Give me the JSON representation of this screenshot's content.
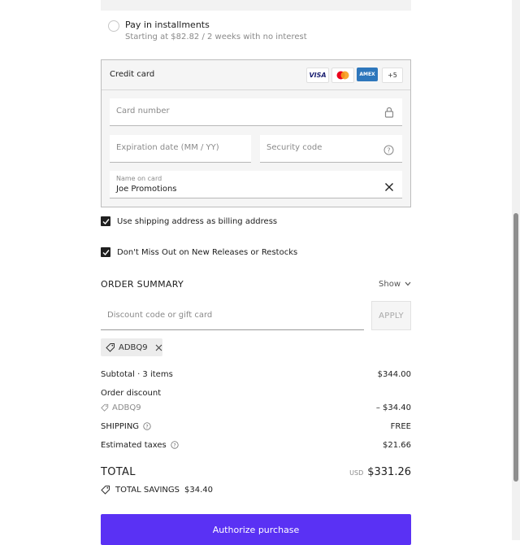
{
  "installments": {
    "label": "Pay in installments",
    "sub": "Starting at $82.82 / 2 weeks with no interest"
  },
  "credit_card": {
    "title": "Credit card",
    "brands": [
      "VISA",
      "",
      "AMEX",
      "+5"
    ],
    "card_number_placeholder": "Card number",
    "expiration_placeholder": "Expiration date (MM / YY)",
    "security_placeholder": "Security code",
    "name_label": "Name on card",
    "name_value": "Joe Promotions"
  },
  "options": {
    "billing_label": "Use shipping address as billing address",
    "newsletter_label": "Don't Miss Out on New Releases or Restocks"
  },
  "summary": {
    "title": "ORDER SUMMARY",
    "toggle_label": "Show",
    "discount_placeholder": "Discount code or gift card",
    "apply_label": "APPLY",
    "code_chip": "ADBQ9",
    "subtotal_label": "Subtotal · 3 items",
    "subtotal_value": "$344.00",
    "order_discount_label": "Order discount",
    "discount_code": "ADBQ9",
    "discount_value": "– $34.40",
    "shipping_label": "SHIPPING",
    "shipping_value": "FREE",
    "taxes_label": "Estimated taxes",
    "taxes_value": "$21.66",
    "total_label": "TOTAL",
    "total_currency": "USD",
    "total_value": "$331.26",
    "savings_label": "TOTAL SAVINGS",
    "savings_value": "$34.40"
  },
  "authorize_label": "Authorize purchase",
  "colors": {
    "accent": "#5a31f4",
    "text": "#202020",
    "muted": "#8a8a8a"
  }
}
